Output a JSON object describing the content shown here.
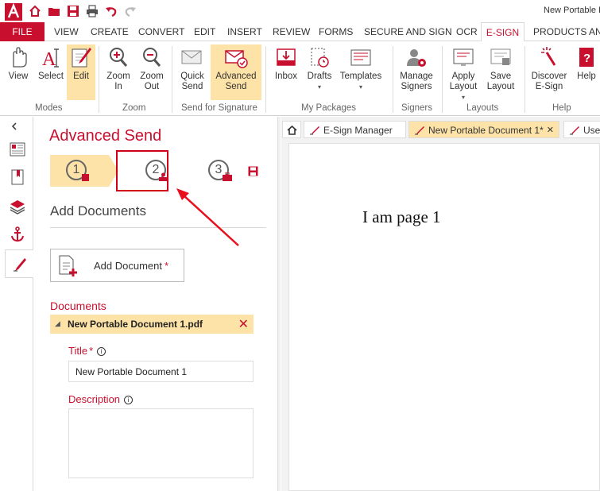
{
  "window": {
    "title": "New Portable D"
  },
  "menu": {
    "tabs": [
      "FILE",
      "VIEW",
      "CREATE",
      "CONVERT",
      "EDIT",
      "INSERT",
      "REVIEW",
      "FORMS",
      "SECURE AND SIGN",
      "OCR",
      "E-SIGN",
      "PRODUCTS AND"
    ],
    "active": "E-SIGN"
  },
  "ribbon": {
    "buttons": {
      "view": "View",
      "select": "Select",
      "edit": "Edit",
      "zoom_in": "Zoom\nIn",
      "zoom_out": "Zoom\nOut",
      "quick_send": "Quick\nSend",
      "advanced_send": "Advanced\nSend",
      "inbox": "Inbox",
      "drafts": "Drafts",
      "templates": "Templates",
      "manage_signers": "Manage\nSigners",
      "apply_layout": "Apply\nLayout",
      "save_layout": "Save\nLayout",
      "discover_esign": "Discover\nE-Sign",
      "help": "Help"
    },
    "groups": {
      "modes": "Modes",
      "zoom": "Zoom",
      "send_for_signature": "Send for Signature",
      "my_packages": "My Packages",
      "signers": "Signers",
      "layouts": "Layouts",
      "help": "Help"
    }
  },
  "panel": {
    "title": "Advanced Send",
    "steps": [
      "1",
      "2",
      "3"
    ],
    "section_title": "Add Documents",
    "add_document_label": "Add Document",
    "required_mark": "*",
    "documents_heading": "Documents",
    "document_name": "New Portable Document 1.pdf",
    "title_label": "Title",
    "title_value": "New Portable Document 1",
    "description_label": "Description"
  },
  "doc_tabs": {
    "home": "",
    "esign_manager": "E-Sign Manager",
    "current": "New Portable Document 1*",
    "close": "✕",
    "third": "Use"
  },
  "document": {
    "page_text": "I am page 1"
  },
  "colors": {
    "brand_red": "#c8102e",
    "highlight": "#fde3a7"
  }
}
